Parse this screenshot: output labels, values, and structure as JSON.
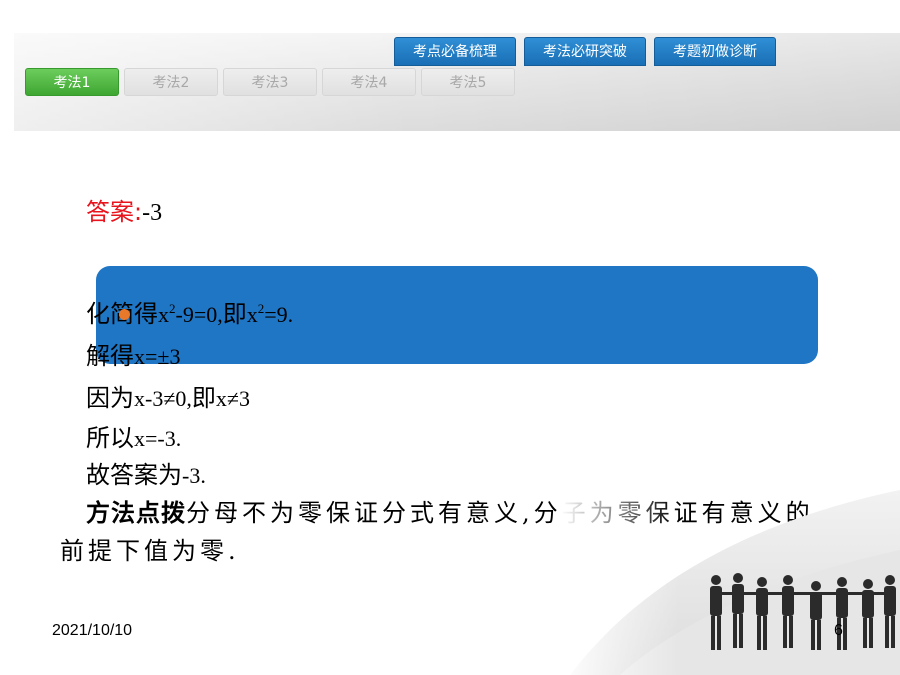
{
  "top_tabs": [
    {
      "label": "考点必备梳理"
    },
    {
      "label": "考法必研突破"
    },
    {
      "label": "考题初做诊断"
    }
  ],
  "method_tabs": [
    {
      "label": "考法1",
      "active": true
    },
    {
      "label": "考法2",
      "active": false
    },
    {
      "label": "考法3",
      "active": false
    },
    {
      "label": "考法4",
      "active": false
    },
    {
      "label": "考法5",
      "active": false
    }
  ],
  "answer": {
    "label": "答案:",
    "value": "-3"
  },
  "solution": {
    "line1": {
      "cn1": "化简得",
      "eq1a": "x",
      "eq1sup": "2",
      "eq1b": "-9=0,",
      "cn2": "即",
      "eq2a": "x",
      "eq2sup": "2",
      "eq2b": "=9."
    },
    "line2": {
      "cn": "解得",
      "eq": "x=±3"
    },
    "line3": {
      "cn1": "因为",
      "eq1": "x-3≠0,",
      "cn2": "即",
      "eq2": "x≠3"
    },
    "line4": {
      "cn": "所以",
      "eq": "x=-3."
    },
    "line5": {
      "cn": "故答案为",
      "eq": "-3."
    }
  },
  "tip": {
    "title": "方法点拨",
    "body": "分母不为零保证分式有意义,分子为零保证有意义的前提下值为零."
  },
  "footer": {
    "date": "2021/10/10",
    "page": "6"
  },
  "colors": {
    "top_tab": "#1f76c5",
    "active_tab": "#4cb33e",
    "answer_label": "#e8141d",
    "blue_box": "#1f76c5"
  }
}
